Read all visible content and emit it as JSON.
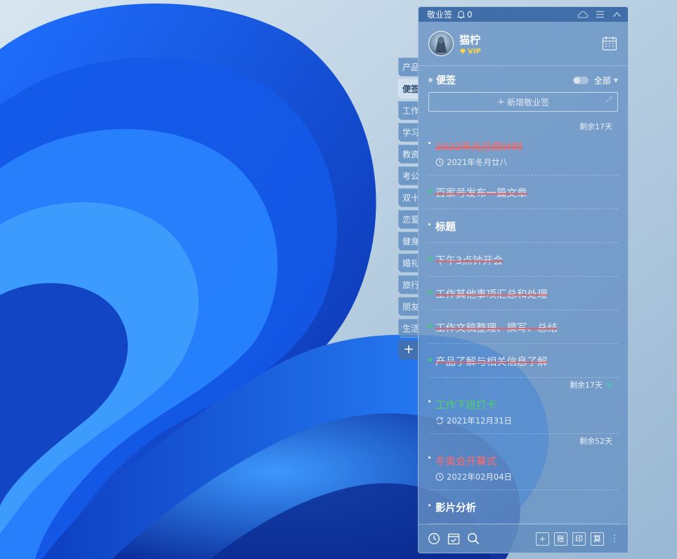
{
  "app": {
    "title": "敬业签",
    "notification_count": "0"
  },
  "user": {
    "name": "猫柠",
    "vip_label": "VIP"
  },
  "categories": [
    {
      "label": "产品",
      "active": false
    },
    {
      "label": "便签",
      "active": true
    },
    {
      "label": "工作",
      "active": false
    },
    {
      "label": "学习",
      "active": false
    },
    {
      "label": "教资",
      "active": false
    },
    {
      "label": "考公",
      "active": false
    },
    {
      "label": "双十",
      "active": false
    },
    {
      "label": "恋爱",
      "active": false
    },
    {
      "label": "健身",
      "active": false
    },
    {
      "label": "婚礼",
      "active": false
    },
    {
      "label": "旅行",
      "active": false
    },
    {
      "label": "朋友",
      "active": false
    },
    {
      "label": "生活",
      "active": false
    }
  ],
  "categories_add_label": "+",
  "section": {
    "title": "便签",
    "filter": "全部"
  },
  "new_note": {
    "label": "新增敬业签",
    "plus": "+"
  },
  "notes": [
    {
      "remaining": "剩余17天",
      "title": "2022年元旦倒计时",
      "style": "red-strike-free",
      "date": "2021年冬月廿八",
      "date_icon": "clock-icon"
    },
    {
      "title": "百家号发布一篇文章",
      "style": "strike",
      "done": true
    },
    {
      "title": "标题",
      "style": "bold"
    },
    {
      "title": "下午3点钟开会",
      "style": "strike",
      "done": true
    },
    {
      "title": "工作其他事项汇总和处理",
      "style": "strike",
      "done": true
    },
    {
      "title": "工作文稿整理、撰写、总结",
      "style": "strike",
      "done": true
    },
    {
      "title": "产品了解与相关信息了解",
      "style": "strike",
      "done": true
    },
    {
      "remaining": "剩余17天",
      "pinned": true,
      "title": "工作下班打卡",
      "style": "green",
      "date": "2021年12月31日",
      "date_icon": "repeat-icon"
    },
    {
      "remaining": "剩余52天",
      "title": "冬奥会开幕式",
      "style": "red",
      "date": "2022年02月04日",
      "date_icon": "clock-icon"
    },
    {
      "title": "影片分析",
      "style": "bold"
    }
  ],
  "footer": {
    "buttons_right": [
      "+",
      "账",
      "印",
      "算"
    ]
  },
  "colors": {
    "panel": "#6892c4",
    "accent_red": "#ff6b6b",
    "accent_green": "#4bd26a",
    "done_dot": "#3cd07a"
  }
}
